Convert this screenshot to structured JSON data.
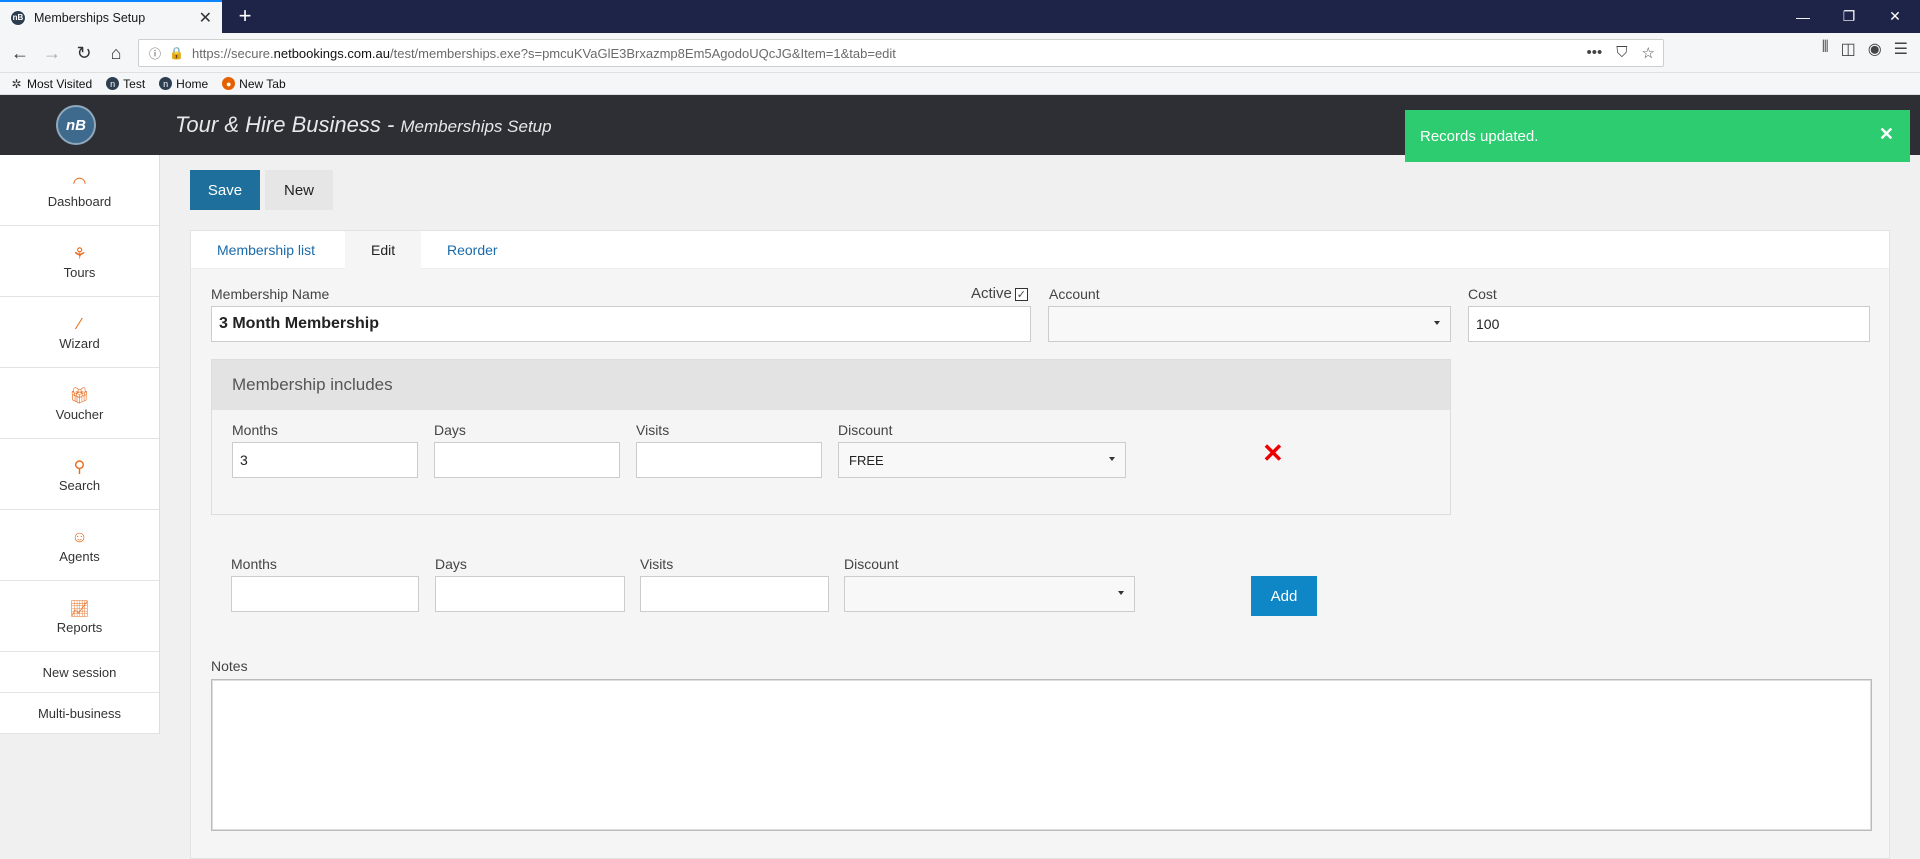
{
  "browser": {
    "tab_title": "Memberships Setup",
    "url_prefix": "https://secure.",
    "url_host": "netbookings.com.au",
    "url_path": "/test/memberships.exe?s=pmcuKVaGlE3Brxazmp8Em5AgodoUQcJG&Item=1&tab=edit",
    "bookmarks": [
      "Most Visited",
      "Test",
      "Home",
      "New Tab"
    ]
  },
  "app": {
    "logo_text": "nB",
    "title": "Tour & Hire Business - ",
    "subtitle": "Memberships Setup"
  },
  "toast": {
    "message": "Records updated."
  },
  "sidebar": {
    "items": [
      {
        "label": "Dashboard",
        "icon": "gauge-icon"
      },
      {
        "label": "Tours",
        "icon": "tours-icon"
      },
      {
        "label": "Wizard",
        "icon": "wand-icon"
      },
      {
        "label": "Voucher",
        "icon": "gift-icon"
      },
      {
        "label": "Search",
        "icon": "search-icon"
      },
      {
        "label": "Agents",
        "icon": "agent-icon"
      },
      {
        "label": "Reports",
        "icon": "chart-icon"
      }
    ],
    "links": [
      "New session",
      "Multi-business"
    ]
  },
  "toolbar": {
    "save_label": "Save",
    "new_label": "New"
  },
  "tabs": [
    "Membership list",
    "Edit",
    "Reorder"
  ],
  "form": {
    "name_label": "Membership Name",
    "name_value": "3 Month Membership",
    "active_label": "Active",
    "active_checked": true,
    "account_label": "Account",
    "account_value": "",
    "cost_label": "Cost",
    "cost_value": "100",
    "includes_title": "Membership includes",
    "include_row": {
      "months_label": "Months",
      "months_value": "3",
      "days_label": "Days",
      "days_value": "",
      "visits_label": "Visits",
      "visits_value": "",
      "discount_label": "Discount",
      "discount_value": "FREE"
    },
    "new_row": {
      "months_label": "Months",
      "days_label": "Days",
      "visits_label": "Visits",
      "discount_label": "Discount"
    },
    "add_label": "Add",
    "notes_label": "Notes",
    "notes_value": ""
  }
}
